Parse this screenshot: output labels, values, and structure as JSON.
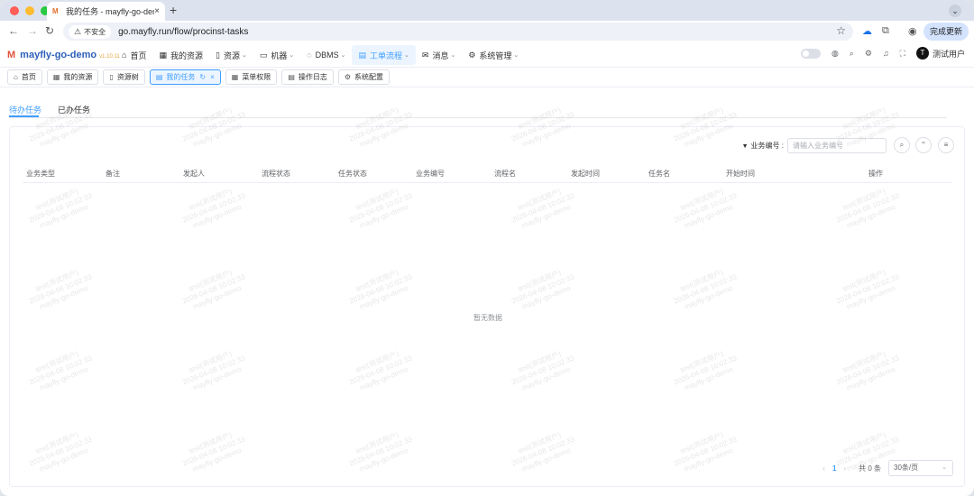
{
  "browser": {
    "tab_title": "我的任务 - mayfly-go-demo",
    "tab_close": "×",
    "new_tab": "+",
    "insecure_label": "不安全",
    "url": "go.mayfly.run/flow/procinst-tasks",
    "update_button": "完成更新"
  },
  "app": {
    "name": "mayfly-go-demo",
    "version": "v1.10.11"
  },
  "menu": [
    {
      "label": "首页",
      "icon": "⌂",
      "dropdown": false
    },
    {
      "label": "我的资源",
      "icon": "▦",
      "dropdown": false
    },
    {
      "label": "资源",
      "icon": "▯",
      "dropdown": true
    },
    {
      "label": "机器",
      "icon": "▭",
      "dropdown": true
    },
    {
      "label": "DBMS",
      "icon": "◌",
      "dropdown": true
    },
    {
      "label": "工单流程",
      "icon": "▤",
      "dropdown": true,
      "active": true
    },
    {
      "label": "消息",
      "icon": "✉",
      "dropdown": true
    },
    {
      "label": "系统管理",
      "icon": "⚙",
      "dropdown": true
    }
  ],
  "user": {
    "avatar_letter": "T",
    "name": "测试用户"
  },
  "tags": [
    {
      "label": "首页",
      "icon": "⌂"
    },
    {
      "label": "我的资源",
      "icon": "▦"
    },
    {
      "label": "资源树",
      "icon": "▯"
    },
    {
      "label": "我的任务",
      "icon": "▤",
      "active": true
    },
    {
      "label": "菜单权限",
      "icon": "▦"
    },
    {
      "label": "操作日志",
      "icon": "▤"
    },
    {
      "label": "系统配置",
      "icon": "⚙"
    }
  ],
  "page_tabs": {
    "todo": "待办任务",
    "done": "已办任务"
  },
  "search": {
    "label": "业务编号 :",
    "placeholder": "请输入业务编号"
  },
  "table": {
    "columns": [
      "业务类型",
      "备注",
      "发起人",
      "流程状态",
      "任务状态",
      "业务编号",
      "流程名",
      "发起时间",
      "任务名",
      "开始时间",
      "操作"
    ],
    "empty_text": "暂无数据"
  },
  "pagination": {
    "current_page": "1",
    "total": "共 0 条",
    "page_size": "30条/页"
  },
  "watermark": {
    "line1": "test(测试用户)",
    "line2": "2026-04-08 10:02:33",
    "line3": "mayfly-go-demo"
  },
  "colors": {
    "accent": "#409eff",
    "brand": "#2d5fb8"
  }
}
